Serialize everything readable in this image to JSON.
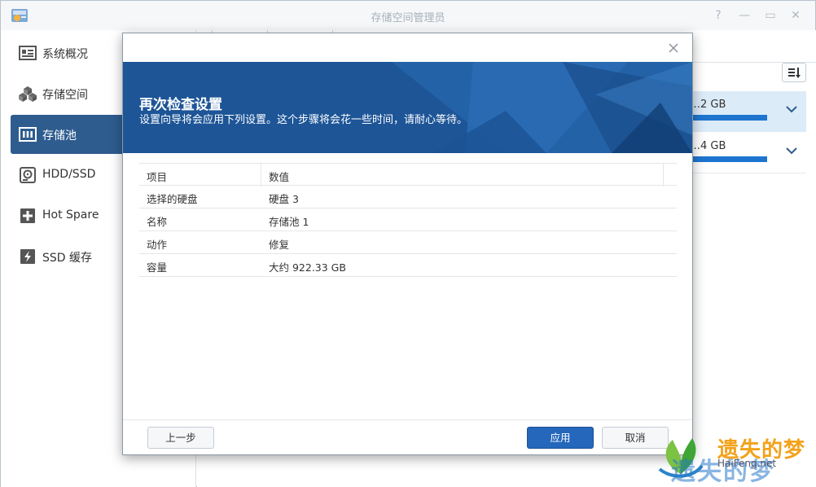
{
  "window": {
    "title": "存储空间管理员",
    "controls": [
      "?",
      "—",
      "▭",
      "✕"
    ]
  },
  "sidebar": {
    "items": [
      {
        "label": "系统概况",
        "icon": "overview-card-icon"
      },
      {
        "label": "存储空间",
        "icon": "cubes-icon"
      },
      {
        "label": "存储池",
        "icon": "storage-pool-icon",
        "active": true
      },
      {
        "label": "HDD/SSD",
        "icon": "disk-icon"
      },
      {
        "label": "Hot Spare",
        "icon": "hot-spare-plus-icon"
      },
      {
        "label": "SSD 缓存",
        "icon": "lightning-icon"
      }
    ]
  },
  "main": {
    "pools": [
      {
        "size": "…2 GB",
        "selected": true
      },
      {
        "size": "…4 GB",
        "selected": false
      }
    ]
  },
  "modal": {
    "title": "再次检查设置",
    "subtitle": "设置向导将会应用下列设置。这个步骤将会花一些时间，请耐心等待。",
    "table": {
      "headers": [
        "项目",
        "数值"
      ],
      "rows": [
        [
          "选择的硬盘",
          "硬盘 3"
        ],
        [
          "名称",
          "存储池 1"
        ],
        [
          "动作",
          "修复"
        ],
        [
          "容量",
          "大约 922.33 GB"
        ]
      ]
    },
    "buttons": {
      "back": "上一步",
      "apply": "应用",
      "cancel": "取消"
    }
  },
  "watermark": {
    "line1": "遗失的梦",
    "line2": "HaiFeng.net",
    "line3": "遗失的梦"
  },
  "colors": {
    "accent": "#2e5c8f",
    "header_blue": "#1d5597",
    "apply_blue": "#2467bb",
    "progress_blue": "#1e75d0"
  }
}
